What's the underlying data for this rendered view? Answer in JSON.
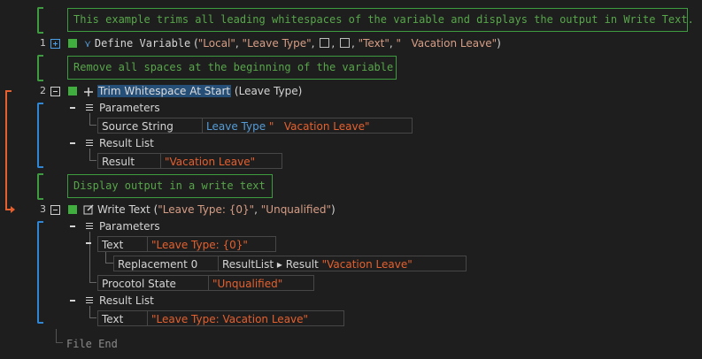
{
  "comments": [
    "This example trims all leading whitespaces of the variable and displays the output in Write Text.",
    "Remove all spaces at the beginning of the variable",
    "Display output in a write text"
  ],
  "line1": {
    "number": "1",
    "cmd": "Define Variable",
    "open": " (",
    "arg1": "\"Local\"",
    "arg2": "\"Leave Type\"",
    "arg5": "\"Text\"",
    "arg6": "\"   Vacation Leave\"",
    "close": ")"
  },
  "line2": {
    "number": "2",
    "cmd": "Trim Whitespace At Start",
    "args": " (Leave Type)",
    "parameters": "Parameters",
    "source_key": "Source String",
    "source_var": "Leave Type",
    "source_val": "\"   Vacation Leave\"",
    "result_list": "Result List",
    "result_key": "Result",
    "result_val": "\"Vacation Leave\""
  },
  "line3": {
    "number": "3",
    "cmd": "Write Text",
    "open": " (",
    "arg1": "\"Leave Type: {0}\"",
    "arg2": "\"Unqualified\"",
    "close": ")",
    "parameters": "Parameters",
    "text_key": "Text",
    "text_val": "\"Leave Type: {0}\"",
    "repl_key": "Replacement 0",
    "repl_path": "ResultList ▸ Result",
    "repl_val": "\"Vacation Leave\"",
    "proto_key": "Procotol State",
    "proto_val": "\"Unqualified\"",
    "result_list": "Result List",
    "result_key": "Text",
    "result_val": "\"Leave Type: Vacation Leave\""
  },
  "file_end": "File End",
  "colors": {
    "comment": "#57a64a",
    "string": "#d69d85",
    "accent_orange": "#e4602f",
    "accent_blue": "#2f86d4"
  }
}
